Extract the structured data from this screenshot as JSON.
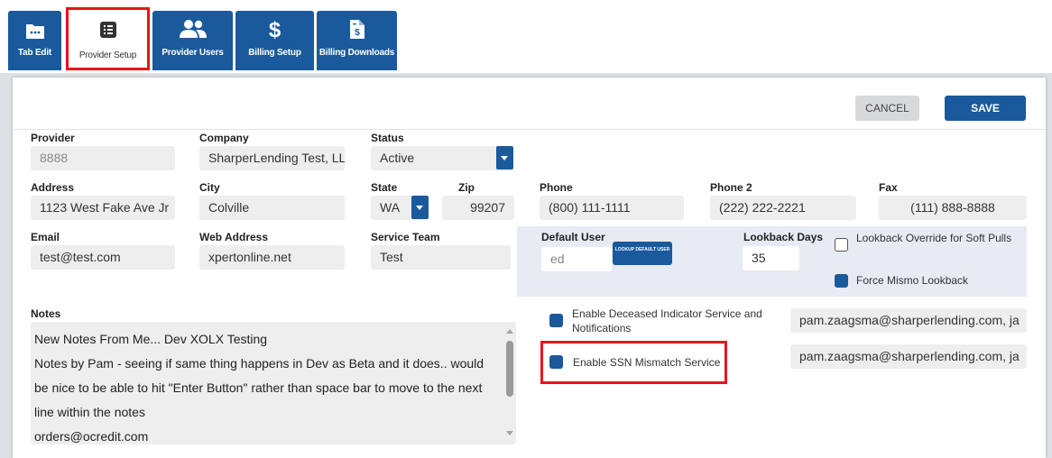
{
  "tabs": [
    {
      "label": "Tab Edit",
      "icon": "folder-icon"
    },
    {
      "label": "Provider Setup",
      "icon": "list-icon"
    },
    {
      "label": "Provider Users",
      "icon": "users-icon"
    },
    {
      "label": "Billing Setup",
      "icon": "dollar-icon"
    },
    {
      "label": "Billing Downloads",
      "icon": "dollar-file-icon"
    }
  ],
  "active_tab": "Provider Setup",
  "actions": {
    "cancel": "CANCEL",
    "save": "SAVE"
  },
  "form": {
    "provider": {
      "label": "Provider",
      "value": "8888"
    },
    "company": {
      "label": "Company",
      "value": "SharperLending Test, LL"
    },
    "status": {
      "label": "Status",
      "value": "Active"
    },
    "address": {
      "label": "Address",
      "value": "1123 West Fake Ave Jr"
    },
    "city": {
      "label": "City",
      "value": "Colville"
    },
    "state": {
      "label": "State",
      "value": "WA"
    },
    "zip": {
      "label": "Zip",
      "value": "99207"
    },
    "phone": {
      "label": "Phone",
      "value": "(800) 111-1111"
    },
    "phone2": {
      "label": "Phone 2",
      "value": "(222) 222-2221"
    },
    "fax": {
      "label": "Fax",
      "value": "(111) 888-8888"
    },
    "email": {
      "label": "Email",
      "value": "test@test.com"
    },
    "web_address": {
      "label": "Web Address",
      "value": "xpertonline.net"
    },
    "service_team": {
      "label": "Service Team",
      "value": "Test"
    },
    "default_user": {
      "label": "Default User",
      "value": "ed",
      "lookup_button": "LOOKUP DEFAULT USER"
    },
    "lookback_days": {
      "label": "Lookback Days",
      "value": "35"
    },
    "lookback_override": {
      "label": "Lookback Override for Soft Pulls",
      "checked": false
    },
    "force_mismo": {
      "label": "Force Mismo Lookback",
      "checked": true
    },
    "notes": {
      "label": "Notes",
      "lines": [
        "New Notes From Me... Dev XOLX Testing",
        "Notes by Pam - seeing if same thing happens in Dev as Beta and it does.. would",
        "be nice to be able to hit \"Enter Button\" rather than space bar to move to the next",
        "line within the notes",
        "orders@ocredit.com"
      ]
    },
    "deceased_service": {
      "label": "Enable Deceased Indicator Service and Notifications",
      "checked": true,
      "email": "pam.zaagsma@sharperlending.com, ja"
    },
    "ssn_mismatch": {
      "label": "Enable SSN Mismatch Service",
      "checked": true,
      "email": "pam.zaagsma@sharperlending.com, ja"
    }
  },
  "colors": {
    "primary": "#1a5a9c",
    "highlight": "#e8141b",
    "field_bg": "#eeeeee"
  }
}
